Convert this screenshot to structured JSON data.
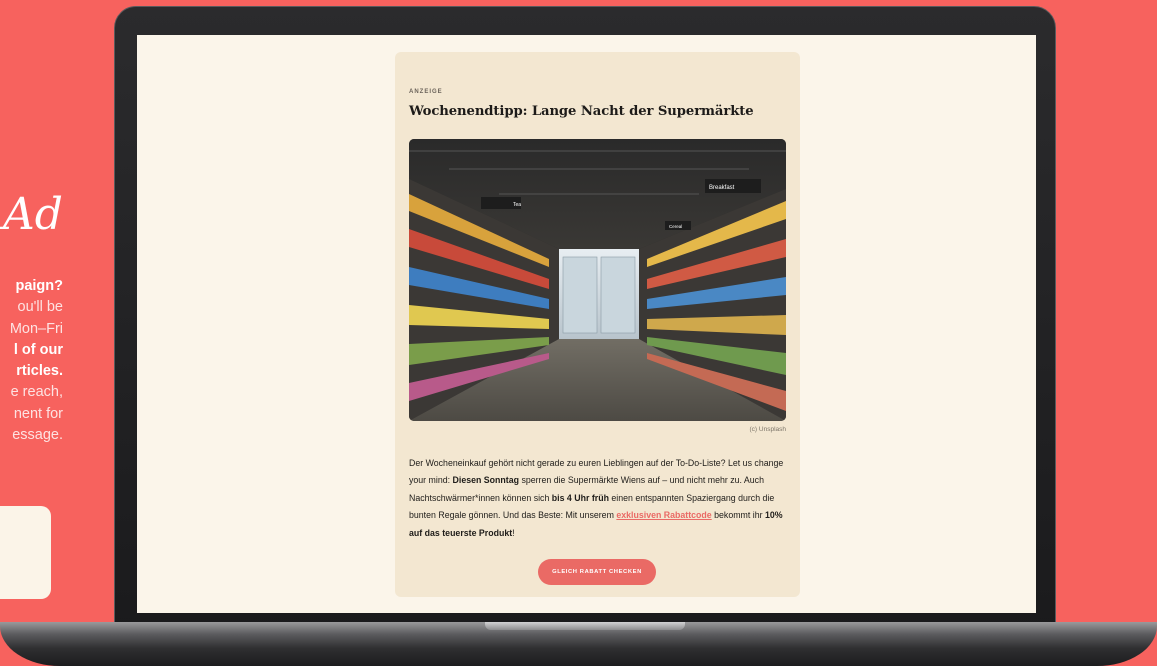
{
  "promo": {
    "ad_heading": "Ad",
    "lines": [
      "paign?",
      "ou'll be",
      "Mon–Fri",
      "l of our",
      "rticles.",
      "e reach,",
      "nent for",
      "essage."
    ]
  },
  "ad": {
    "label": "ANZEIGE",
    "title": "Wochenendtipp: Lange Nacht der Supermärkte",
    "image_alt": "supermarket-aisle-photo",
    "credit": "(c) Unsplash",
    "body": {
      "p1": "Der Wocheneinkauf gehört nicht gerade zu euren Lieblingen auf der To-Do-Liste? Let us change your mind: ",
      "b1": "Diesen Sonntag",
      "p2": " sperren die Supermärkte Wiens auf – und nicht mehr zu. Auch Nachtschwärmer*innen können sich ",
      "b2": "bis 4 Uhr früh",
      "p3": " einen entspannten Spaziergang durch die bunten Regale gönnen. Und das Beste: Mit unserem ",
      "link": "exklusiven Rabattcode",
      "p4": " bekommt ihr ",
      "b3": "10% auf das teuerste Produkt",
      "p5": "!"
    },
    "cta": "GLEICH RABATT CHECKEN",
    "store_signs": {
      "left": "Tea",
      "right": "Breakfast",
      "right_small": "Cereal"
    }
  },
  "colors": {
    "background": "#f7625e",
    "accent": "#ea6a65",
    "card": "#f3e7d1",
    "screen": "#fbf5ea"
  }
}
